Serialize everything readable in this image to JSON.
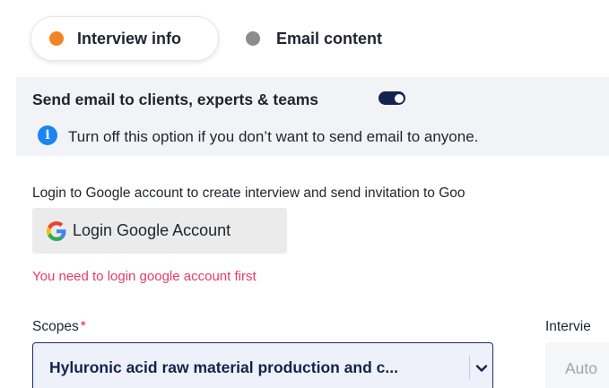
{
  "tabs": [
    {
      "label": "Interview info",
      "active": true,
      "dot_color": "#f28423"
    },
    {
      "label": "Email content",
      "active": false,
      "dot_color": "#8c8c8c"
    }
  ],
  "send_email": {
    "title": "Send email to clients, experts & teams",
    "enabled": true,
    "info_text": "Turn off this option if you don’t want to send email to anyone."
  },
  "login": {
    "description": "Login to Google account to create interview and send invitation to Goo",
    "button_label": "Login Google Account",
    "error_text": "You need to login google account first"
  },
  "scopes": {
    "label": "Scopes",
    "required_mark": "*",
    "value": "Hyluronic acid raw material production and c..."
  },
  "interview_field": {
    "label": "Intervie",
    "placeholder": "Auto"
  },
  "colors": {
    "accent_orange": "#f28423",
    "navy": "#14224e",
    "info_blue": "#1a84ef",
    "error_pink": "#ea3a6a"
  }
}
